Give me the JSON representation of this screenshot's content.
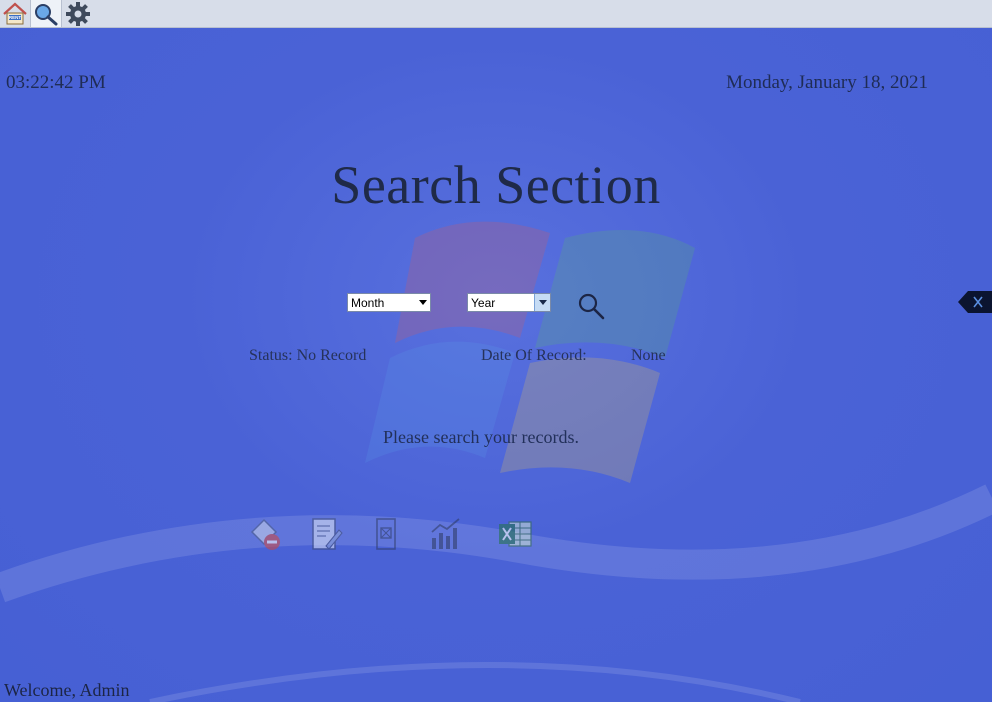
{
  "toolbar": {
    "buttons": [
      {
        "name": "home-icon",
        "label": "RENT"
      },
      {
        "name": "search-icon"
      },
      {
        "name": "gear-icon"
      }
    ]
  },
  "header": {
    "time": "03:22:42 PM",
    "date": "Monday, January 18, 2021"
  },
  "main": {
    "title": "Search Section",
    "month_select": {
      "value": "Month"
    },
    "year_select": {
      "value": "Year"
    },
    "status_label": "Status: No Record",
    "date_of_record_label": "Date Of Record:",
    "date_of_record_value": "None",
    "message": "Please search your records."
  },
  "actions": [
    {
      "name": "delete-record-icon"
    },
    {
      "name": "edit-record-icon"
    },
    {
      "name": "print-icon"
    },
    {
      "name": "chart-icon"
    },
    {
      "name": "excel-export-icon"
    }
  ],
  "footer": {
    "welcome": "Welcome, Admin"
  },
  "colors": {
    "background": "#4a62d6",
    "toolbar": "#d7dde9",
    "text": "#1f2a48"
  }
}
